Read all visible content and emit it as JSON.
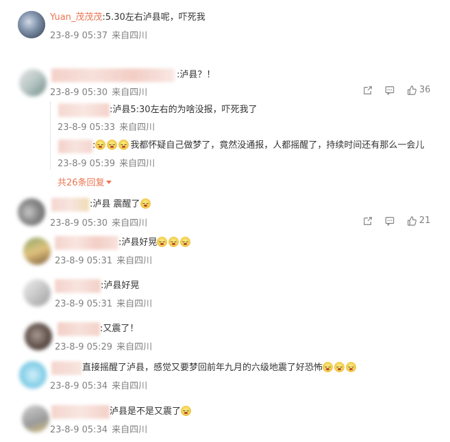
{
  "top_comment": {
    "username": "Yuan_茂茂茂",
    "text": ":5.30左右泸县呢，吓死我",
    "time": "23-8-9 05:37",
    "source": "来自四川"
  },
  "comments": [
    {
      "text": ":泸县？！",
      "time": "23-8-9 05:30",
      "source": "来自四川",
      "likes": "36"
    },
    {
      "text": ":泸县 震醒了",
      "time": "23-8-9 05:30",
      "source": "来自四川",
      "likes": "21"
    },
    {
      "text": ":泸县好晃",
      "time": "23-8-9 05:31",
      "source": "来自四川"
    },
    {
      "text": ":泸县好晃",
      "time": "23-8-9 05:31",
      "source": "来自四川"
    },
    {
      "text": ":又震了！",
      "time": "23-8-9 05:29",
      "source": "来自四川"
    },
    {
      "text": "直接摇醒了泸县，感觉又要梦回前年九月的六级地震了好恐怖",
      "time": "23-8-9 05:34",
      "source": "来自四川"
    },
    {
      "text": "泸县是不是又震了",
      "time": "23-8-9 05:34",
      "source": "来自四川"
    }
  ],
  "replies": [
    {
      "text": ":泸县5:30左右的为啥没报，吓死我了",
      "time": "23-8-9 05:33",
      "source": "来自四川"
    },
    {
      "text": "我都怀疑自己做梦了，竟然没通报，人都摇醒了，持续时间还有那么一会儿",
      "time": "23-8-9 05:39",
      "source": "来自四川"
    }
  ],
  "more_replies_label": "共26条回复",
  "icons": {
    "share": "share-icon",
    "comment": "comment-icon",
    "like": "thumbs-up-icon"
  },
  "colors": {
    "username": "#eb7350",
    "meta": "#808080",
    "link": "#eb7350"
  }
}
